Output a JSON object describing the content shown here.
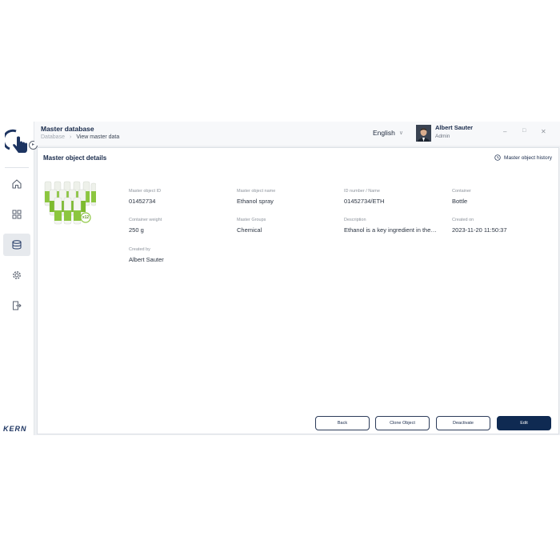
{
  "header": {
    "title": "Master database",
    "breadcrumb": [
      "Database",
      "View master data"
    ],
    "language": "English",
    "user": {
      "name": "Albert Sauter",
      "role": "Admin"
    }
  },
  "brand": "KERN",
  "card": {
    "title": "Master object details",
    "history_label": "Master object history",
    "product_badge": "x12",
    "fields": [
      {
        "label": "Master object ID",
        "value": "01452734"
      },
      {
        "label": "Master object name",
        "value": "Ethanol spray"
      },
      {
        "label": "ID number / Name",
        "value": "01452734/ETH"
      },
      {
        "label": "Container",
        "value": "Bottle"
      },
      {
        "label": "Container weight",
        "value": "250 g"
      },
      {
        "label": "Master Groups",
        "value": "Chemical"
      },
      {
        "label": "Description",
        "value": "Ethanol is a key ingredient in the…"
      },
      {
        "label": "Created on",
        "value": "2023-11-20 11:50:37"
      },
      {
        "label": "Created by",
        "value": "Albert Sauter"
      }
    ],
    "actions": {
      "back": "Back",
      "clone": "Clone Object",
      "deactivate": "Deactivate",
      "edit": "Edit"
    }
  },
  "colors": {
    "primary": "#0f2a52",
    "accent": "#17294a",
    "background": "#eef0f3",
    "product_green": "#8cc63f"
  },
  "icons": {
    "sidebar": [
      "home-icon",
      "apps-grid-icon",
      "database-icon",
      "settings-gear-icon",
      "logout-icon"
    ],
    "window": [
      "minimize-icon",
      "maximize-icon",
      "close-icon"
    ]
  }
}
